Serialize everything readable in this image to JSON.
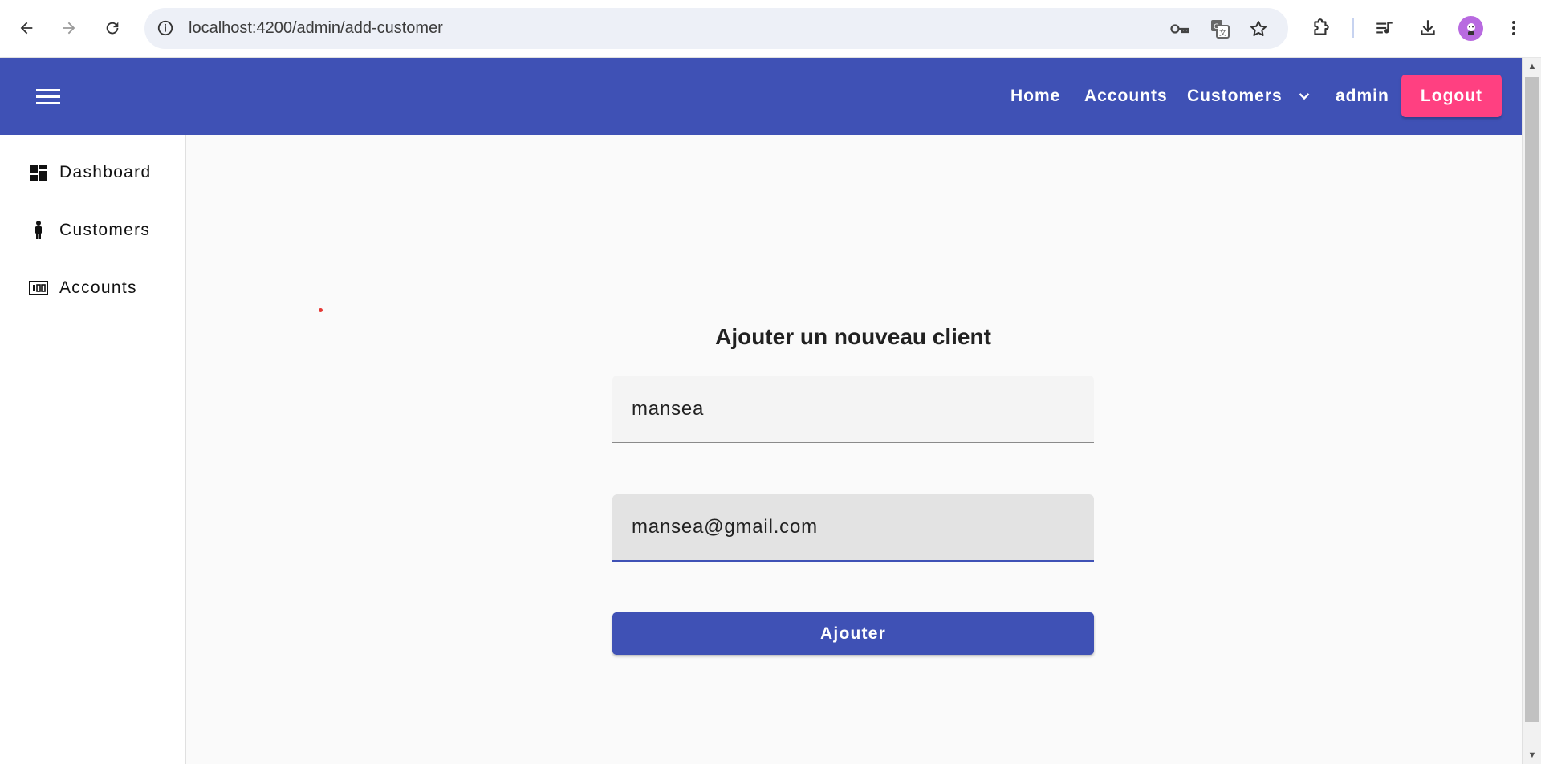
{
  "browser": {
    "url": "localhost:4200/admin/add-customer",
    "icons": [
      "back-arrow-icon",
      "forward-arrow-icon",
      "reload-icon",
      "site-info-icon",
      "password-key-icon",
      "translate-icon",
      "bookmark-star-icon",
      "extensions-icon",
      "media-queue-icon",
      "download-icon",
      "profile-avatar-icon",
      "more-vert-icon"
    ]
  },
  "toolbar": {
    "color": "#3f51b5",
    "nav": {
      "home": "Home",
      "accounts": "Accounts",
      "customers": "Customers",
      "user": "admin"
    },
    "logout": "Logout",
    "logout_color": "#ff4081"
  },
  "sidebar": {
    "items": [
      {
        "label": "Dashboard",
        "icon": "dashboard-icon"
      },
      {
        "label": "Customers",
        "icon": "person-icon"
      },
      {
        "label": "Accounts",
        "icon": "account-card-icon"
      }
    ]
  },
  "form": {
    "title": "Ajouter un nouveau client",
    "name_value": "mansea",
    "email_value": "mansea@gmail.com",
    "submit_label": "Ajouter"
  }
}
